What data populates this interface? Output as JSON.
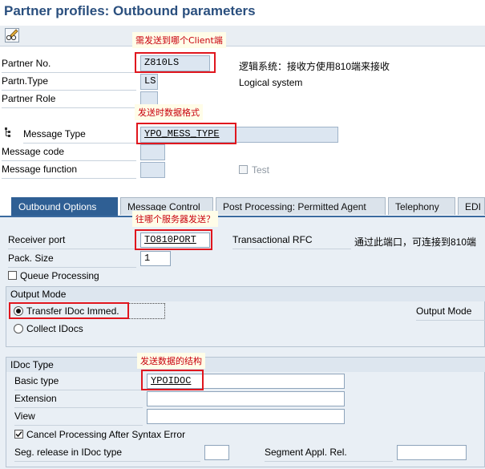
{
  "title": "Partner profiles: Outbound parameters",
  "toolbar": {
    "edit_icon": "pencil-glasses-icon"
  },
  "partner": {
    "partner_no_label": "Partner No.",
    "partner_no_value": "Z810LS",
    "partner_no_note": "逻辑系统：接收方使用810端来接收",
    "partner_type_label": "Partn.Type",
    "partner_type_value": "LS",
    "partner_type_desc": "Logical system",
    "partner_role_label": "Partner Role",
    "message_type_label": "Message Type",
    "message_type_value": "YPO_MESS_TYPE",
    "message_code_label": "Message code",
    "message_function_label": "Message function",
    "test_label": "Test"
  },
  "annotations": {
    "client": "需发送到哪个Client端",
    "format": "发送时数据格式",
    "server": "往哪个服务器发送？",
    "structure": "发送数据的结构"
  },
  "tabs": [
    {
      "label": "Outbound Options",
      "active": true
    },
    {
      "label": "Message Control"
    },
    {
      "label": "Post Processing: Permitted Agent"
    },
    {
      "label": "Telephony"
    },
    {
      "label": "EDI"
    }
  ],
  "outbound": {
    "receiver_port_label": "Receiver port",
    "receiver_port_value": "TO810PORT",
    "receiver_port_desc": "Transactional RFC",
    "receiver_port_note": "通过此端口，可连接到810端",
    "pack_size_label": "Pack. Size",
    "pack_size_value": "1",
    "queue_processing_label": "Queue Processing",
    "output_mode_title": "Output Mode",
    "transfer_immed_label": "Transfer IDoc Immed.",
    "collect_idocs_label": "Collect IDocs",
    "output_mode_right_label": "Output Mode"
  },
  "idoc": {
    "group_title": "IDoc Type",
    "basic_type_label": "Basic type",
    "basic_type_value": "YPOIDOC",
    "extension_label": "Extension",
    "view_label": "View",
    "cancel_processing_label": "Cancel Processing After Syntax Error",
    "seg_release_label": "Seg. release in IDoc type",
    "segment_appl_label": "Segment Appl. Rel."
  },
  "colors": {
    "title": "#2a4f7e",
    "active_tab": "#2f5f94",
    "annotation": "#e0161e"
  }
}
